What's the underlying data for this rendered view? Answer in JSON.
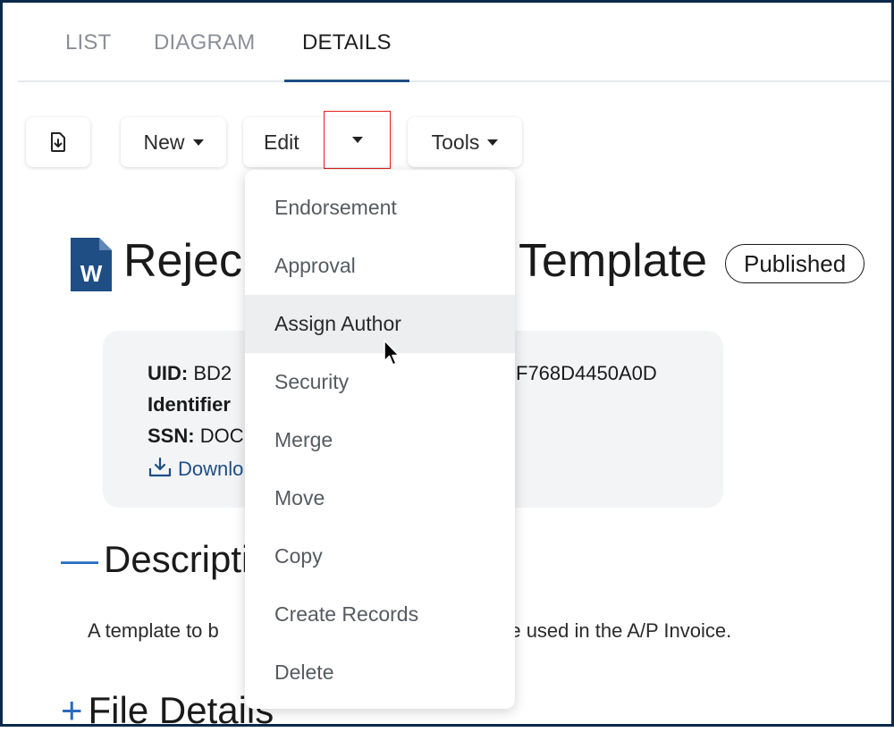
{
  "tabs": [
    {
      "label": "LIST"
    },
    {
      "label": "DIAGRAM"
    },
    {
      "label": "DETAILS",
      "active": true
    }
  ],
  "toolbar": {
    "export_icon": "download-file-icon",
    "new_label": "New",
    "edit_label": "Edit",
    "tools_label": "Tools"
  },
  "document": {
    "icon": "word-document-icon",
    "title_left": "Rejec",
    "title_right": "Template",
    "status": "Published"
  },
  "meta": {
    "uid_label": "UID:",
    "uid_value_left": "BD2",
    "uid_value_right": "F768D4450A0D",
    "identifier_label": "Identifier",
    "ssn_label": "SSN:",
    "ssn_value": "DOC",
    "download_label": "Downlo"
  },
  "sections": {
    "description_title": "Descripti",
    "description_text_left": "A template to b",
    "description_text_right": "ote used in the A/P Invoice.",
    "file_details_title": "File Details"
  },
  "dropdown": {
    "items": [
      {
        "label": "Endorsement"
      },
      {
        "label": "Approval"
      },
      {
        "label": "Assign Author",
        "hovered": true
      },
      {
        "label": "Security"
      },
      {
        "label": "Merge"
      },
      {
        "label": "Move"
      },
      {
        "label": "Copy"
      },
      {
        "label": "Create Records"
      },
      {
        "label": "Delete"
      }
    ]
  },
  "colors": {
    "accent": "#1e4e84",
    "highlight_border": "#e02020",
    "section_sign": "#2a6bbd",
    "frame": "#0b2a4a"
  }
}
